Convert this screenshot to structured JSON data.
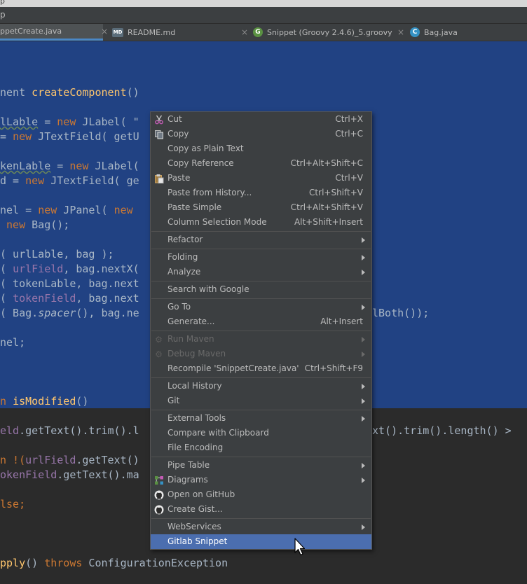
{
  "window": {
    "title_fragment": "p"
  },
  "menubar": {
    "text": "p"
  },
  "tabs": [
    {
      "label": "SnippetCreate.java",
      "display": "ppetCreate.java",
      "icon": "java-class-icon",
      "active": true
    },
    {
      "label": "README.md",
      "icon": "markdown-file-icon",
      "active": false
    },
    {
      "label": "Snippet (Groovy 2.4.6)_5.groovy",
      "icon": "groovy-file-icon",
      "icon_letter": "G",
      "active": false
    },
    {
      "label": "Bag.java",
      "icon": "java-class-icon",
      "icon_letter": "C",
      "active": false
    }
  ],
  "close_glyph": "×",
  "code": {
    "line1_a": "nent ",
    "line1_fn": "createComponent",
    "line1_b": "()",
    "line2_a": "lLable",
    "line2_b": " = ",
    "line2_kw": "new",
    "line2_c": " JLabel( \"",
    "line3_a": "= ",
    "line3_kw": "new",
    "line3_b": " JTextField( getU",
    "line4_a": "kenLable",
    "line4_b": " = ",
    "line4_kw": "new",
    "line4_c": " JLabel(",
    "line5_a": "d = ",
    "line5_kw": "new",
    "line5_b": " JTextField( ge",
    "line6_a": "nel = ",
    "line6_kw": "new",
    "line6_b": " JPanel( ",
    "line6_kw2": "new",
    "line7_a": " ",
    "line7_kw": "new",
    "line7_b": " Bag();",
    "line8": "( urlLable, bag );",
    "line9_a": "( ",
    "line9_f": "urlField",
    "line9_b": ", bag.nextX(",
    "line10": "( tokenLable, bag.next",
    "line11_a": "( ",
    "line11_f": "tokenField",
    "line11_b": ", bag.next",
    "line12_a": "( Bag.",
    "line12_i": "spacer",
    "line12_b": "(), bag.ne",
    "line12_tail": "lBoth());",
    "line13": "nel;",
    "line14_a": "n ",
    "line14_fn": "isModified",
    "line14_b": "()",
    "line15_f": "eld",
    "line15_a": ".getText().trim().l",
    "line15_tail": "xt().trim().length() >",
    "line16_a": "n !(",
    "line16_f": "urlField",
    "line16_b": ".getText()",
    "line17_f": "okenField",
    "line17_a": ".getText().ma",
    "line18_kw": "lse",
    "line18_b": ";",
    "line19_a": "pply",
    "line19_b": "() ",
    "line19_kw": "throws",
    "line19_c": " ConfigurationException"
  },
  "context_menu": {
    "items": [
      {
        "label": "Cut",
        "shortcut": "Ctrl+X",
        "icon": "scissors-icon"
      },
      {
        "label": "Copy",
        "shortcut": "Ctrl+C",
        "icon": "copy-icon"
      },
      {
        "label": "Copy as Plain Text",
        "shortcut": ""
      },
      {
        "label": "Copy Reference",
        "shortcut": "Ctrl+Alt+Shift+C"
      },
      {
        "label": "Paste",
        "shortcut": "Ctrl+V",
        "icon": "paste-icon"
      },
      {
        "label": "Paste from History...",
        "shortcut": "Ctrl+Shift+V"
      },
      {
        "label": "Paste Simple",
        "shortcut": "Ctrl+Alt+Shift+V"
      },
      {
        "label": "Column Selection Mode",
        "shortcut": "Alt+Shift+Insert"
      },
      {
        "label": "Refactor",
        "submenu": true
      },
      {
        "label": "Folding",
        "submenu": true
      },
      {
        "label": "Analyze",
        "submenu": true
      },
      {
        "label": "Search with Google"
      },
      {
        "label": "Go To",
        "submenu": true
      },
      {
        "label": "Generate...",
        "shortcut": "Alt+Insert"
      },
      {
        "label": "Run Maven",
        "submenu": true,
        "disabled": true,
        "icon": "maven-gear-icon"
      },
      {
        "label": "Debug Maven",
        "submenu": true,
        "disabled": true,
        "icon": "maven-gear-icon"
      },
      {
        "label": "Recompile 'SnippetCreate.java'",
        "shortcut": "Ctrl+Shift+F9"
      },
      {
        "label": "Local History",
        "submenu": true
      },
      {
        "label": "Git",
        "submenu": true
      },
      {
        "label": "External Tools",
        "submenu": true
      },
      {
        "label": "Compare with Clipboard"
      },
      {
        "label": "File Encoding"
      },
      {
        "label": "Pipe Table",
        "submenu": true
      },
      {
        "label": "Diagrams",
        "submenu": true,
        "icon": "diagram-icon"
      },
      {
        "label": "Open on GitHub",
        "icon": "github-icon"
      },
      {
        "label": "Create Gist...",
        "icon": "github-icon"
      },
      {
        "label": "WebServices",
        "submenu": true
      },
      {
        "label": "Gitlab Snippet",
        "highlighted": true
      }
    ]
  },
  "colors": {
    "editor_bg": "#2b2b2b",
    "selection": "#214283",
    "menu_bg": "#3c3f41",
    "menu_highlight": "#4b6eaf",
    "keyword": "#cc7832",
    "method": "#ffc66d",
    "field": "#9876aa"
  }
}
